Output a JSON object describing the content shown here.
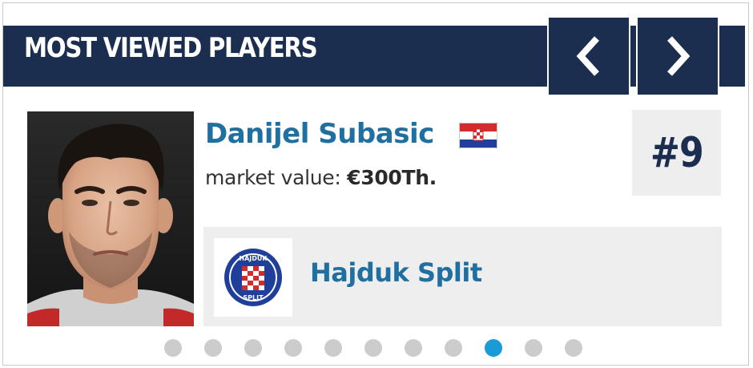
{
  "header": {
    "title": "MOST VIEWED PLAYERS",
    "prev_icon": "chevron-left-icon",
    "next_icon": "chevron-right-icon"
  },
  "player": {
    "name": "Danijel Subasic",
    "nationality_flag": "croatia-flag-icon",
    "market_value_label": "market value:",
    "market_value": "€300Th.",
    "rank": "#9",
    "club": {
      "name": "Hajduk Split",
      "crest_text_top": "HAJDUK",
      "crest_text_bottom": "SPLIT"
    }
  },
  "pagination": {
    "total": 11,
    "active_index": 8
  },
  "colors": {
    "header_navy": "#1b2e4f",
    "name_blue": "#1f6fa0",
    "dot_active": "#1a9ad6",
    "dot_inactive": "#cccccc",
    "panel_gray": "#eeeeee"
  }
}
